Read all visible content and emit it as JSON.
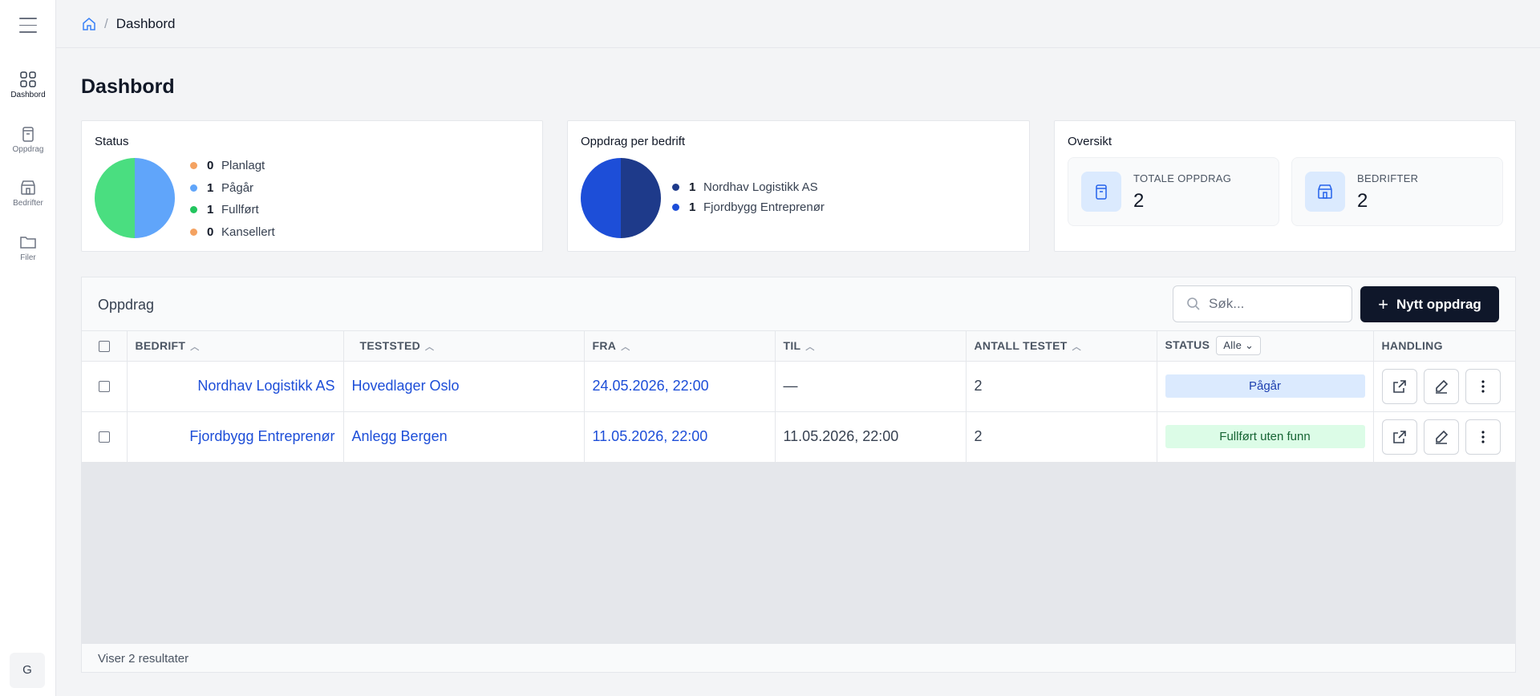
{
  "sidebar": {
    "items": [
      {
        "label": "Dashbord",
        "icon": "grid-icon"
      },
      {
        "label": "Oppdrag",
        "icon": "clipboard-icon"
      },
      {
        "label": "Bedrifter",
        "icon": "store-icon"
      },
      {
        "label": "Filer",
        "icon": "folder-icon"
      }
    ],
    "avatar_initial": "G"
  },
  "breadcrumb": {
    "separator": "/",
    "current": "Dashbord"
  },
  "page_title": "Dashbord",
  "status_card": {
    "title": "Status",
    "items": [
      {
        "count": "0",
        "label": "Planlagt",
        "color": "#f4a261"
      },
      {
        "count": "1",
        "label": "Pågår",
        "color": "#60a5fa"
      },
      {
        "count": "1",
        "label": "Fullført",
        "color": "#22c55e"
      },
      {
        "count": "0",
        "label": "Kansellert",
        "color": "#f4a261"
      }
    ]
  },
  "company_card": {
    "title": "Oppdrag per bedrift",
    "items": [
      {
        "count": "1",
        "label": "Nordhav Logistikk AS",
        "color": "#1e3a8a"
      },
      {
        "count": "1",
        "label": "Fjordbygg Entreprenør",
        "color": "#1d4ed8"
      }
    ]
  },
  "overview_card": {
    "title": "Oversikt",
    "stats": [
      {
        "label": "TOTALE OPPDRAG",
        "value": "2",
        "icon": "clipboard-icon"
      },
      {
        "label": "BEDRIFTER",
        "value": "2",
        "icon": "store-icon"
      }
    ]
  },
  "table": {
    "title": "Oppdrag",
    "search_placeholder": "Søk...",
    "new_button": "Nytt oppdrag",
    "columns": {
      "company": "BEDRIFT",
      "site": "TESTSTED",
      "from": "FRA",
      "to": "TIL",
      "tested": "ANTALL TESTET",
      "status": "STATUS",
      "status_filter": "Alle",
      "actions": "HANDLING"
    },
    "rows": [
      {
        "company": "Nordhav Logistikk AS",
        "site": "Hovedlager Oslo",
        "from": "24.05.2026, 22:00",
        "to": "—",
        "tested": "2",
        "status": "Pågår"
      },
      {
        "company": "Fjordbygg Entreprenør",
        "site": "Anlegg Bergen",
        "from": "11.05.2026, 22:00",
        "to": "11.05.2026, 22:00",
        "tested": "2",
        "status": "Fullført uten funn"
      }
    ],
    "footer": "Viser 2 resultater"
  },
  "colors": {
    "accent": "#1d4ed8",
    "dark_button": "#0f172a",
    "badge_blue": "#dbeafe",
    "badge_green": "#dcfce7"
  }
}
